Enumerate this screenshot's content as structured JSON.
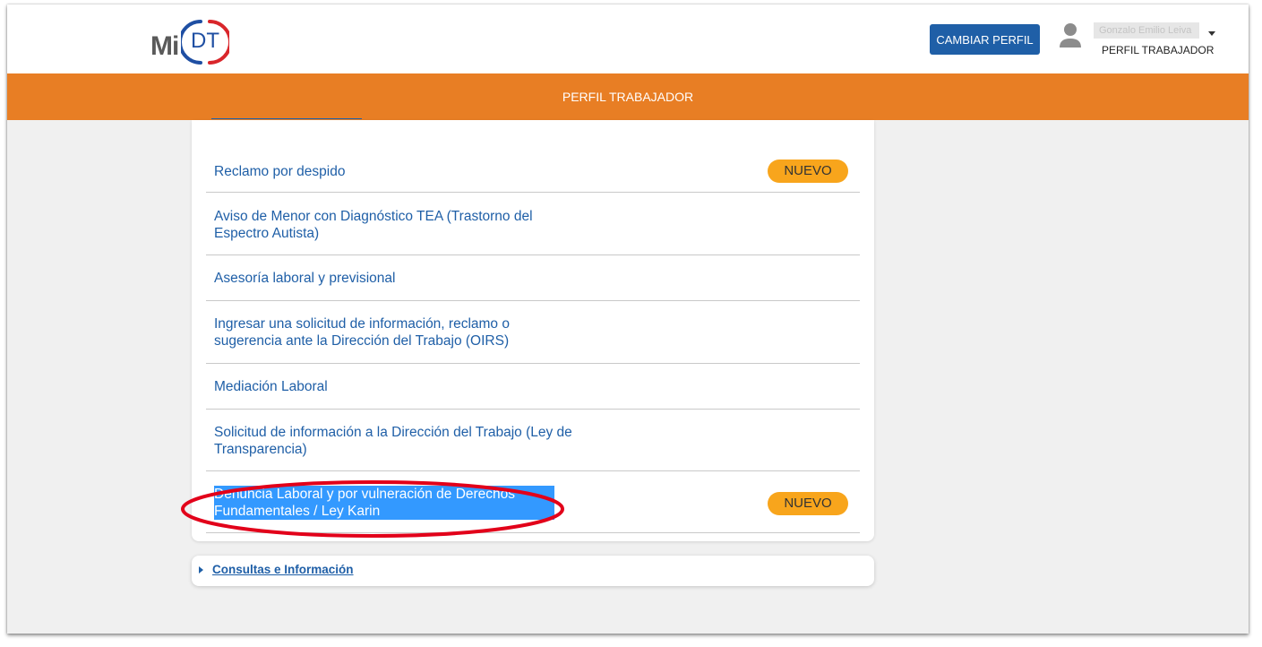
{
  "header": {
    "logo_mi": "Mi",
    "logo_dt": "DT",
    "change_profile_label": "CAMBIAR PERFIL",
    "user_name": "Gonzalo Emilio Leiva",
    "user_role": "PERFIL TRABAJADOR"
  },
  "banner": {
    "title": "PERFIL TRABAJADOR"
  },
  "services": {
    "items": [
      {
        "label": "Reclamo por despido",
        "badge": "NUEVO"
      },
      {
        "label": "Aviso de Menor con Diagnóstico TEA (Trastorno del Espectro Autista)"
      },
      {
        "label": "Asesoría laboral y previsional"
      },
      {
        "label": "Ingresar una solicitud de información, reclamo o sugerencia ante la Dirección del Trabajo (OIRS)"
      },
      {
        "label": "Mediación Laboral"
      },
      {
        "label": "Solicitud de información a la Dirección del Trabajo (Ley de Transparencia)"
      },
      {
        "label": "Denuncia Laboral y por vulneración de Derechos Fundamentales / Ley Karin",
        "badge": "NUEVO"
      }
    ]
  },
  "consultas": {
    "label": "Consultas e Información"
  },
  "colors": {
    "brand_orange": "#e87e24",
    "link_blue": "#1f5fa7",
    "badge_yellow": "#f8a51c",
    "annotation_red": "#e2001a",
    "selection_blue": "#3399ff"
  }
}
